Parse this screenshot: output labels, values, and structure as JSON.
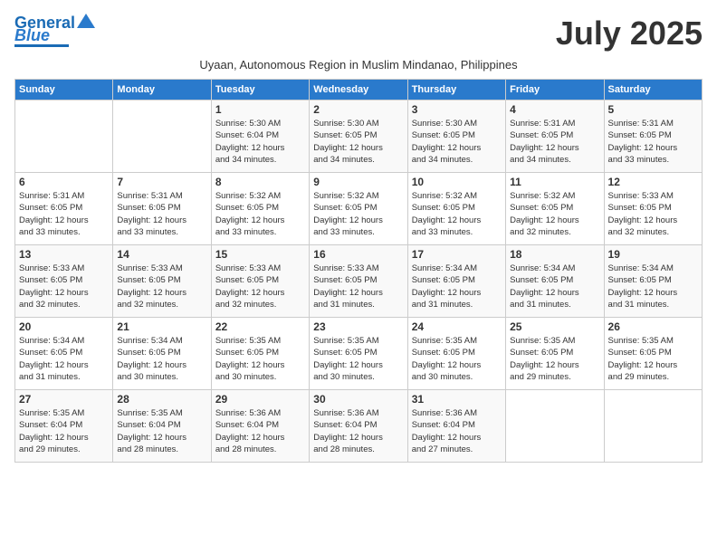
{
  "header": {
    "logo_line1": "General",
    "logo_line2": "Blue",
    "month_title": "July 2025",
    "subtitle": "Uyaan, Autonomous Region in Muslim Mindanao, Philippines"
  },
  "weekdays": [
    "Sunday",
    "Monday",
    "Tuesday",
    "Wednesday",
    "Thursday",
    "Friday",
    "Saturday"
  ],
  "weeks": [
    [
      {
        "day": "",
        "info": ""
      },
      {
        "day": "",
        "info": ""
      },
      {
        "day": "1",
        "info": "Sunrise: 5:30 AM\nSunset: 6:04 PM\nDaylight: 12 hours\nand 34 minutes."
      },
      {
        "day": "2",
        "info": "Sunrise: 5:30 AM\nSunset: 6:05 PM\nDaylight: 12 hours\nand 34 minutes."
      },
      {
        "day": "3",
        "info": "Sunrise: 5:30 AM\nSunset: 6:05 PM\nDaylight: 12 hours\nand 34 minutes."
      },
      {
        "day": "4",
        "info": "Sunrise: 5:31 AM\nSunset: 6:05 PM\nDaylight: 12 hours\nand 34 minutes."
      },
      {
        "day": "5",
        "info": "Sunrise: 5:31 AM\nSunset: 6:05 PM\nDaylight: 12 hours\nand 33 minutes."
      }
    ],
    [
      {
        "day": "6",
        "info": "Sunrise: 5:31 AM\nSunset: 6:05 PM\nDaylight: 12 hours\nand 33 minutes."
      },
      {
        "day": "7",
        "info": "Sunrise: 5:31 AM\nSunset: 6:05 PM\nDaylight: 12 hours\nand 33 minutes."
      },
      {
        "day": "8",
        "info": "Sunrise: 5:32 AM\nSunset: 6:05 PM\nDaylight: 12 hours\nand 33 minutes."
      },
      {
        "day": "9",
        "info": "Sunrise: 5:32 AM\nSunset: 6:05 PM\nDaylight: 12 hours\nand 33 minutes."
      },
      {
        "day": "10",
        "info": "Sunrise: 5:32 AM\nSunset: 6:05 PM\nDaylight: 12 hours\nand 33 minutes."
      },
      {
        "day": "11",
        "info": "Sunrise: 5:32 AM\nSunset: 6:05 PM\nDaylight: 12 hours\nand 32 minutes."
      },
      {
        "day": "12",
        "info": "Sunrise: 5:33 AM\nSunset: 6:05 PM\nDaylight: 12 hours\nand 32 minutes."
      }
    ],
    [
      {
        "day": "13",
        "info": "Sunrise: 5:33 AM\nSunset: 6:05 PM\nDaylight: 12 hours\nand 32 minutes."
      },
      {
        "day": "14",
        "info": "Sunrise: 5:33 AM\nSunset: 6:05 PM\nDaylight: 12 hours\nand 32 minutes."
      },
      {
        "day": "15",
        "info": "Sunrise: 5:33 AM\nSunset: 6:05 PM\nDaylight: 12 hours\nand 32 minutes."
      },
      {
        "day": "16",
        "info": "Sunrise: 5:33 AM\nSunset: 6:05 PM\nDaylight: 12 hours\nand 31 minutes."
      },
      {
        "day": "17",
        "info": "Sunrise: 5:34 AM\nSunset: 6:05 PM\nDaylight: 12 hours\nand 31 minutes."
      },
      {
        "day": "18",
        "info": "Sunrise: 5:34 AM\nSunset: 6:05 PM\nDaylight: 12 hours\nand 31 minutes."
      },
      {
        "day": "19",
        "info": "Sunrise: 5:34 AM\nSunset: 6:05 PM\nDaylight: 12 hours\nand 31 minutes."
      }
    ],
    [
      {
        "day": "20",
        "info": "Sunrise: 5:34 AM\nSunset: 6:05 PM\nDaylight: 12 hours\nand 31 minutes."
      },
      {
        "day": "21",
        "info": "Sunrise: 5:34 AM\nSunset: 6:05 PM\nDaylight: 12 hours\nand 30 minutes."
      },
      {
        "day": "22",
        "info": "Sunrise: 5:35 AM\nSunset: 6:05 PM\nDaylight: 12 hours\nand 30 minutes."
      },
      {
        "day": "23",
        "info": "Sunrise: 5:35 AM\nSunset: 6:05 PM\nDaylight: 12 hours\nand 30 minutes."
      },
      {
        "day": "24",
        "info": "Sunrise: 5:35 AM\nSunset: 6:05 PM\nDaylight: 12 hours\nand 30 minutes."
      },
      {
        "day": "25",
        "info": "Sunrise: 5:35 AM\nSunset: 6:05 PM\nDaylight: 12 hours\nand 29 minutes."
      },
      {
        "day": "26",
        "info": "Sunrise: 5:35 AM\nSunset: 6:05 PM\nDaylight: 12 hours\nand 29 minutes."
      }
    ],
    [
      {
        "day": "27",
        "info": "Sunrise: 5:35 AM\nSunset: 6:04 PM\nDaylight: 12 hours\nand 29 minutes."
      },
      {
        "day": "28",
        "info": "Sunrise: 5:35 AM\nSunset: 6:04 PM\nDaylight: 12 hours\nand 28 minutes."
      },
      {
        "day": "29",
        "info": "Sunrise: 5:36 AM\nSunset: 6:04 PM\nDaylight: 12 hours\nand 28 minutes."
      },
      {
        "day": "30",
        "info": "Sunrise: 5:36 AM\nSunset: 6:04 PM\nDaylight: 12 hours\nand 28 minutes."
      },
      {
        "day": "31",
        "info": "Sunrise: 5:36 AM\nSunset: 6:04 PM\nDaylight: 12 hours\nand 27 minutes."
      },
      {
        "day": "",
        "info": ""
      },
      {
        "day": "",
        "info": ""
      }
    ]
  ]
}
